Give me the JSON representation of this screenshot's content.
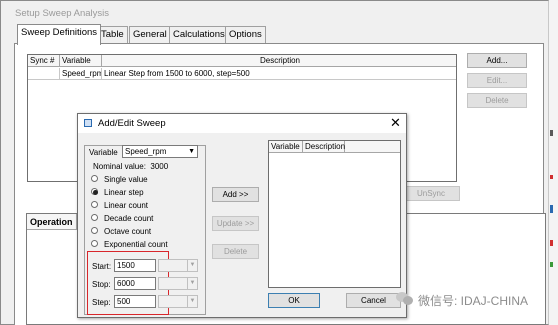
{
  "window": {
    "title": "Setup Sweep Analysis"
  },
  "tabs": [
    "Sweep Definitions",
    "Table",
    "General",
    "Calculations",
    "Options"
  ],
  "sweep_table": {
    "columns": [
      "Sync #",
      "Variable",
      "Description"
    ],
    "rows": [
      {
        "sync": "",
        "variable": "Speed_rpm",
        "description": "Linear Step from 1500 to 6000, step=500"
      }
    ]
  },
  "side_buttons": {
    "add": "Add...",
    "edit": "Edit...",
    "delete": "Delete"
  },
  "unsync_button": "UnSync",
  "operation_header": "Operation",
  "dialog": {
    "title": "Add/Edit Sweep",
    "variable_label": "Variable",
    "variable_value": "Speed_rpm",
    "nominal_label": "Nominal value:",
    "nominal_value": "3000",
    "sweep_types": [
      {
        "label": "Single value",
        "selected": false
      },
      {
        "label": "Linear step",
        "selected": true
      },
      {
        "label": "Linear count",
        "selected": false
      },
      {
        "label": "Decade count",
        "selected": false
      },
      {
        "label": "Octave count",
        "selected": false
      },
      {
        "label": "Exponential count",
        "selected": false
      }
    ],
    "params": [
      {
        "label": "Start:",
        "value": "1500"
      },
      {
        "label": "Stop:",
        "value": "6000"
      },
      {
        "label": "Step:",
        "value": "500"
      }
    ],
    "buttons": {
      "add": "Add >>",
      "update": "Update >>",
      "delete": "Delete",
      "ok": "OK",
      "cancel": "Cancel"
    },
    "list_columns": [
      "Variable",
      "Description"
    ]
  },
  "watermark": "微信号: IDAJ-CHINA",
  "colors": {
    "highlight": "#d8262b",
    "window_bg": "#f0f0f0"
  }
}
